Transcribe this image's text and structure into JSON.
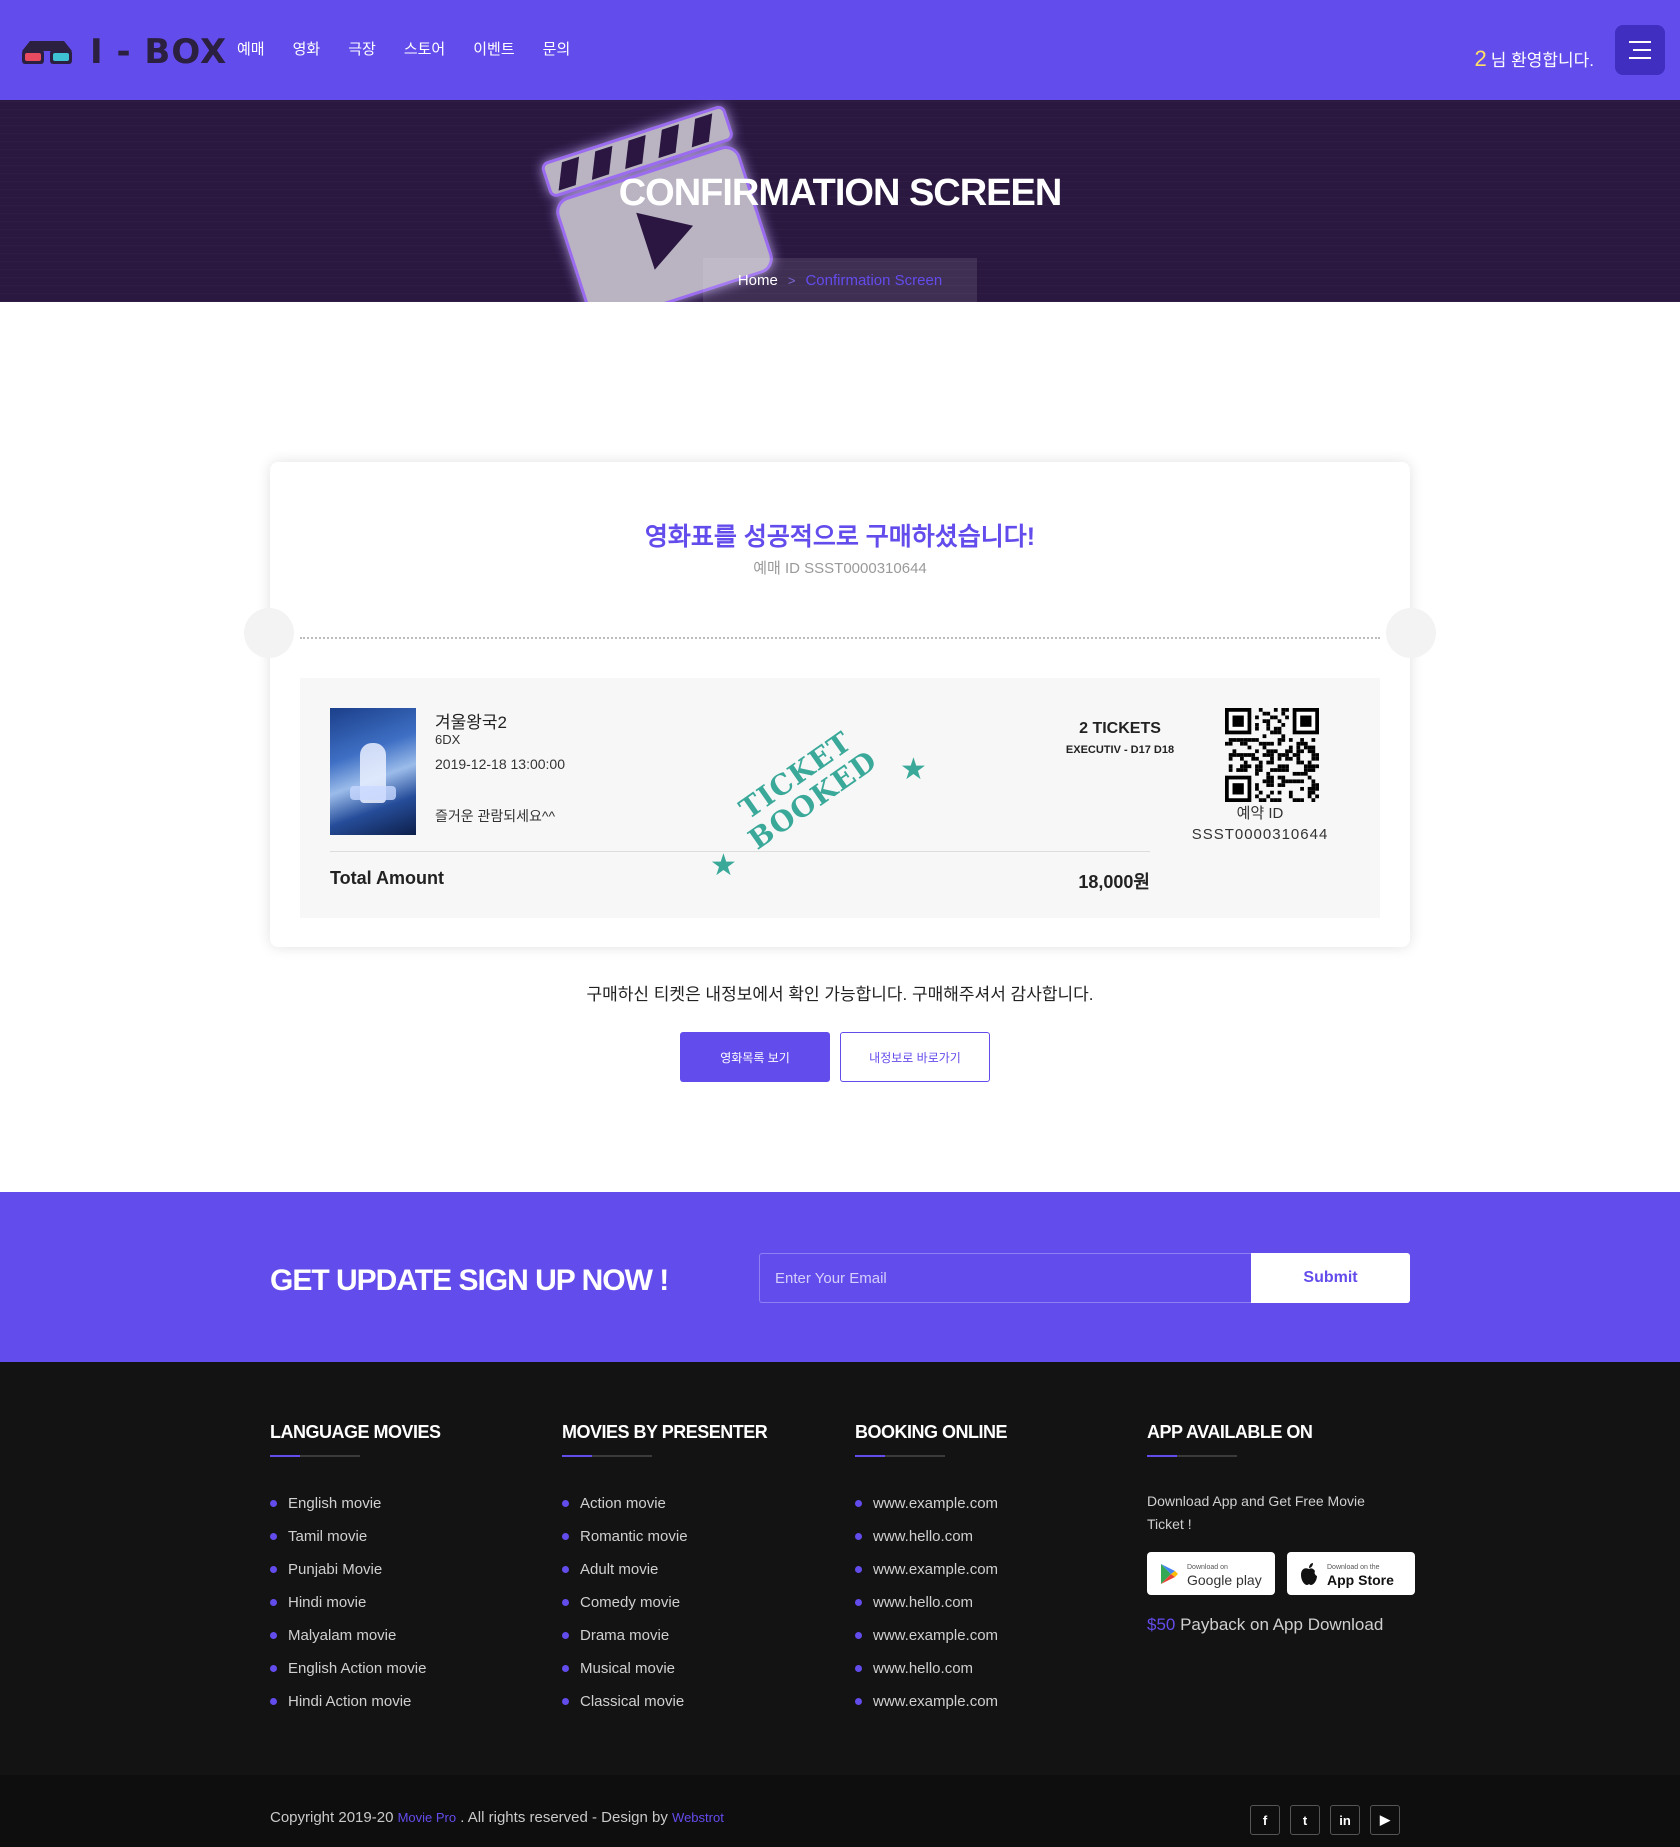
{
  "nav": {
    "logo_text": "I - BOX",
    "menu": [
      "예매",
      "영화",
      "극장",
      "스토어",
      "이벤트",
      "문의"
    ],
    "welcome_number": "2",
    "welcome_text": "님 환영합니다.",
    "menu_icon": "hamburger-icon"
  },
  "hero": {
    "title": "CONFIRMATION SCREEN",
    "breadcrumb_home": "Home",
    "breadcrumb_sep": ">",
    "breadcrumb_current": "Confirmation Screen"
  },
  "confirmation": {
    "headline": "영화표를 성공적으로 구매하셨습니다!",
    "booking_id_line": "예매 ID SSST0000310644",
    "movie_title": "겨울왕국2",
    "format": "6DX",
    "datetime": "2019-12-18 13:00:00",
    "message": "즐거운 관람되세요^^",
    "tickets": "2 TICKETS",
    "seats": "EXECUTIV - D17 D18",
    "stamp_line1": "TICKET",
    "stamp_line2": "BOOKED",
    "total_label": "Total Amount",
    "total_value": "18,000원",
    "reservation_label": "예약 ID",
    "reservation_id": "SSST0000310644"
  },
  "note": "구매하신 티켓은 내정보에서 확인 가능합니다. 구매해주셔서 감사합니다.",
  "buttons": {
    "movie_list": "영화목록 보기",
    "my_info": "내정보로 바로가기"
  },
  "newsletter": {
    "title": "GET UPDATE SIGN UP NOW !",
    "placeholder": "Enter Your Email",
    "submit": "Submit"
  },
  "footer": {
    "language_movies": {
      "title": "LANGUAGE MOVIES",
      "items": [
        "English movie",
        "Tamil movie",
        "Punjabi Movie",
        "Hindi movie",
        "Malyalam movie",
        "English Action movie",
        "Hindi Action movie"
      ]
    },
    "movies_by_presenter": {
      "title": "MOVIES BY PRESENTER",
      "items": [
        "Action movie",
        "Romantic movie",
        "Adult movie",
        "Comedy movie",
        "Drama movie",
        "Musical movie",
        "Classical movie"
      ]
    },
    "booking_online": {
      "title": "BOOKING ONLINE",
      "items": [
        "www.example.com",
        "www.hello.com",
        "www.example.com",
        "www.hello.com",
        "www.example.com",
        "www.hello.com",
        "www.example.com"
      ]
    },
    "app": {
      "title": "APP AVAILABLE ON",
      "text": "Download App and Get Free Movie Ticket !",
      "google_small": "Download on",
      "google_big": "Google play",
      "apple_small": "Download on the",
      "apple_big": "App Store",
      "payback_amount": "$50",
      "payback_text": " Payback on App Download"
    },
    "copyright_pre": "Copyright 2019-20 ",
    "copyright_brand": "Movie Pro",
    "copyright_mid": " . All rights reserved - Design by ",
    "copyright_designer": "Webstrot",
    "social": [
      "f",
      "t",
      "in",
      "▶"
    ]
  },
  "colors": {
    "accent": "#634cec",
    "hero_bg": "#2a1840",
    "footer_bg": "#131313",
    "stamp": "#3aa99a"
  }
}
